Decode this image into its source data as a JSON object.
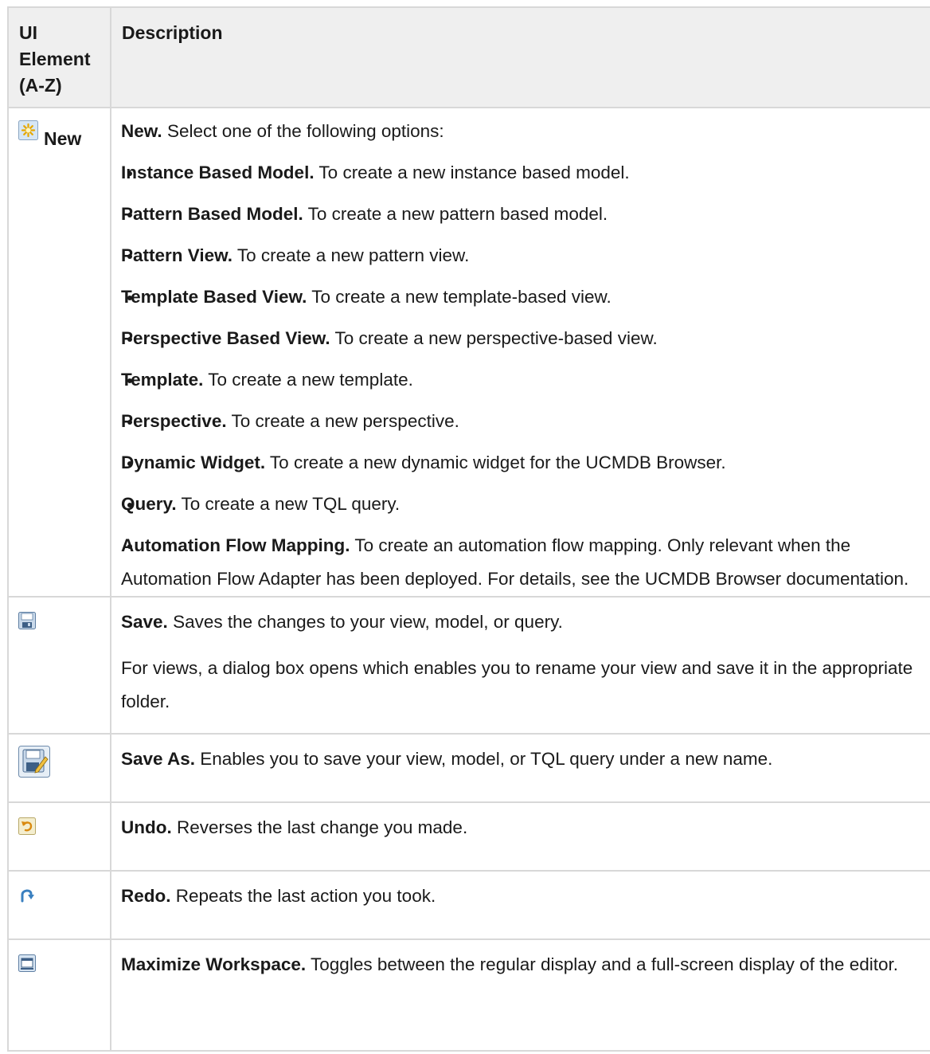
{
  "header": {
    "element_col": [
      "UI",
      "Element",
      "(A-Z)"
    ],
    "description_col": "Description"
  },
  "new_row": {
    "element_label": "New",
    "lead_bold": "New.",
    "lead_text": " Select one of the following options:",
    "options": [
      {
        "bold": "Instance Based Model.",
        "text": " To create a new instance based model."
      },
      {
        "bold": "Pattern Based Model.",
        "text": " To create a new pattern based model."
      },
      {
        "bold": "Pattern View.",
        "text": " To create a new pattern view."
      },
      {
        "bold": "Template Based View.",
        "text": " To create a new template-based view."
      },
      {
        "bold": "Perspective Based View.",
        "text": " To create a new perspective-based view."
      },
      {
        "bold": "Template.",
        "text": " To create a new template."
      },
      {
        "bold": "Perspective.",
        "text": " To create a new perspective."
      },
      {
        "bold": "Dynamic Widget.",
        "text": " To create a new dynamic widget for the UCMDB Browser."
      },
      {
        "bold": "Query.",
        "text": " To create a new TQL query."
      },
      {
        "bold": "Automation Flow Mapping.",
        "text": " To create an automation flow mapping. Only relevant when the Automation Flow Adapter has been deployed. For details, see the UCMDB Browser documentation."
      }
    ]
  },
  "save_row": {
    "icon": "save-icon",
    "bold": "Save.",
    "text": " Saves the changes to your view, model, or query.",
    "note": "For views, a dialog box opens which enables you to rename your view and save it in the appropriate folder."
  },
  "save_as_row": {
    "icon": "save-as-icon",
    "bold": "Save As.",
    "text": " Enables you to save your view, model, or TQL query under a new name."
  },
  "undo_row": {
    "icon": "undo-icon",
    "bold": "Undo.",
    "text": " Reverses the last change you made."
  },
  "redo_row": {
    "icon": "redo-icon",
    "bold": "Redo.",
    "text": " Repeats the last action you took."
  },
  "maximize_row": {
    "icon": "maximize-workspace-icon",
    "bold": "Maximize Workspace.",
    "text": " Toggles between the regular display and a full-screen display of the editor."
  }
}
